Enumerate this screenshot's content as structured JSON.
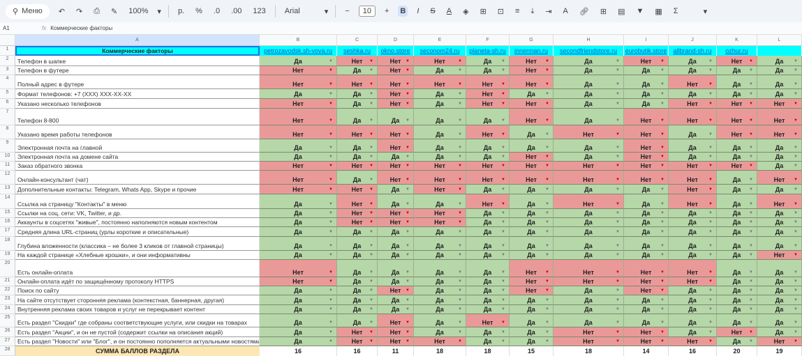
{
  "toolbar": {
    "menu": "Меню",
    "zoom": "100%",
    "currency": "р.",
    "percent": "%",
    "dec_less": ".0",
    "dec_more": ".00",
    "format": "123",
    "font": "Arial",
    "font_size": "10",
    "bold": "B",
    "italic": "I",
    "strike": "S",
    "color": "A"
  },
  "formula": {
    "cell": "A1",
    "fx": "fx",
    "value": "Коммерческие факторы"
  },
  "columns": [
    "A",
    "B",
    "C",
    "D",
    "E",
    "F",
    "G",
    "H",
    "I",
    "J",
    "K",
    "L"
  ],
  "header": {
    "title": "Коммерческие факторы",
    "sites": [
      "petrozavodsk.sh-vova.ru",
      "seshka.ru",
      "okno.store",
      "seconom24.ru",
      "planeta-sh.ru",
      "innerman.ru",
      "secondfriendstore.ru",
      "eurobutik.store",
      "allbrand-sh.ru",
      "ozhur.ru",
      ""
    ]
  },
  "rows": [
    {
      "label": "Телефон в шапке",
      "v": [
        "Да",
        "Нет",
        "Нет",
        "Нет",
        "Да",
        "Нет",
        "Да",
        "Нет",
        "Да",
        "Нет",
        "Да"
      ]
    },
    {
      "label": "Телефон в футере",
      "v": [
        "Нет",
        "Да",
        "Нет",
        "Да",
        "Да",
        "Нет",
        "Да",
        "Да",
        "Да",
        "Да",
        "Да"
      ]
    },
    {
      "label": "Полный адрес в футере",
      "v": [
        "Нет",
        "Нет",
        "Нет",
        "Нет",
        "Нет",
        "Нет",
        "Да",
        "Да",
        "Нет",
        "Да",
        "Да"
      ]
    },
    {
      "label": "Формат телефонов: +7 (XXX) XXX-XX-XX",
      "v": [
        "Да",
        "Да",
        "Нет",
        "Да",
        "Нет",
        "Да",
        "Да",
        "Да",
        "Да",
        "Да",
        "Да"
      ]
    },
    {
      "label": "Указано несколько телефонов",
      "v": [
        "Нет",
        "Да",
        "Нет",
        "Да",
        "Нет",
        "Нет",
        "Да",
        "Да",
        "Нет",
        "Нет",
        "Нет"
      ]
    },
    {
      "label": "Телефон 8-800",
      "v": [
        "Нет",
        "Да",
        "Да",
        "Да",
        "Да",
        "Нет",
        "Да",
        "Нет",
        "Нет",
        "Нет",
        "Нет"
      ]
    },
    {
      "label": "Указано время работы телефонов",
      "v": [
        "Нет",
        "Нет",
        "Нет",
        "Да",
        "Нет",
        "Да",
        "Нет",
        "Нет",
        "Да",
        "Нет",
        "Нет"
      ]
    },
    {
      "label": "Электронная почта на главной",
      "v": [
        "Да",
        "Да",
        "Нет",
        "Да",
        "Да",
        "Да",
        "Да",
        "Нет",
        "Да",
        "Да",
        "Да"
      ]
    },
    {
      "label": "Электронная почта на домене сайта",
      "v": [
        "Да",
        "Да",
        "Да",
        "Да",
        "Да",
        "Нет",
        "Да",
        "Нет",
        "Да",
        "Да",
        "Да"
      ]
    },
    {
      "label": "Заказ обратного звонка",
      "v": [
        "Нет",
        "Нет",
        "Нет",
        "Нет",
        "Нет",
        "Нет",
        "Нет",
        "Нет",
        "Нет",
        "Нет",
        "Да"
      ]
    },
    {
      "label": "Онлайн-консультант (чат)",
      "v": [
        "Нет",
        "Да",
        "Нет",
        "Нет",
        "Нет",
        "Нет",
        "Нет",
        "Нет",
        "Нет",
        "Да",
        "Нет"
      ]
    },
    {
      "label": "Дополнительные контакты: Telegram, Whats App, Skype и прочие",
      "v": [
        "Нет",
        "Нет",
        "Да",
        "Нет",
        "Да",
        "Да",
        "Да",
        "Да",
        "Нет",
        "Да",
        "Да"
      ]
    },
    {
      "label": "Ссылка на страницу \"Контакты\" в меню",
      "v": [
        "Да",
        "Нет",
        "Да",
        "Да",
        "Нет",
        "Да",
        "Нет",
        "Да",
        "Нет",
        "Да",
        "Нет"
      ]
    },
    {
      "label": "Ссылки на соц. сети: VK, Twitter, и др.",
      "v": [
        "Да",
        "Нет",
        "Нет",
        "Нет",
        "Да",
        "Да",
        "Да",
        "Да",
        "Да",
        "Да",
        "Да"
      ]
    },
    {
      "label": "Аккаунты в соцсетях \"живые\", постоянно наполняются новым контентом",
      "v": [
        "Да",
        "Нет",
        "Нет",
        "Нет",
        "Да",
        "Да",
        "Да",
        "Да",
        "Да",
        "Да",
        "Да"
      ]
    },
    {
      "label": "Средняя длина URL-страниц (урлы короткие и описательные)",
      "v": [
        "Да",
        "Да",
        "Да",
        "Да",
        "Да",
        "Да",
        "Да",
        "Да",
        "Да",
        "Да",
        "Да"
      ]
    },
    {
      "label": "Глубина вложенности (классика – не более 3 кликов от главной страницы)",
      "v": [
        "Да",
        "Да",
        "Да",
        "Да",
        "Да",
        "Да",
        "Да",
        "Да",
        "Да",
        "Да",
        "Да"
      ]
    },
    {
      "label": "На каждой странице «Хлебные крошки», и они информативны",
      "v": [
        "Да",
        "Да",
        "Да",
        "Да",
        "Да",
        "Да",
        "Да",
        "Да",
        "Да",
        "Да",
        "Нет"
      ]
    },
    {
      "label": "Есть онлайн-оплата",
      "v": [
        "Нет",
        "Да",
        "Да",
        "Да",
        "Да",
        "Нет",
        "Нет",
        "Нет",
        "Нет",
        "Да",
        "Да"
      ]
    },
    {
      "label": "Онлайн-оплата идёт по защищённому протоколу HTTPS",
      "v": [
        "Нет",
        "Да",
        "Да",
        "Да",
        "Да",
        "Нет",
        "Нет",
        "Нет",
        "Нет",
        "Да",
        "Да"
      ]
    },
    {
      "label": "Поиск по сайту",
      "v": [
        "Да",
        "Да",
        "Нет",
        "Да",
        "Да",
        "Нет",
        "Да",
        "Нет",
        "Да",
        "Да",
        "Да"
      ]
    },
    {
      "label": "На сайте отсутствует сторонняя реклама (контекстная, баннерная, другая)",
      "v": [
        "Да",
        "Да",
        "Да",
        "Да",
        "Да",
        "Да",
        "Да",
        "Да",
        "Да",
        "Да",
        "Да"
      ]
    },
    {
      "label": "Внутренняя реклама своих товаров и услуг не перекрывает контент",
      "v": [
        "Да",
        "Да",
        "Да",
        "Да",
        "Да",
        "Да",
        "Да",
        "Да",
        "Да",
        "Да",
        "Да"
      ]
    },
    {
      "label": "Есть раздел \"Скидки\" где собраны соответствующие услуги, или скидки на товарах",
      "v": [
        "Да",
        "Да",
        "Нет",
        "Да",
        "Нет",
        "Да",
        "Да",
        "Да",
        "Да",
        "Да",
        "Да"
      ]
    },
    {
      "label": "Есть раздел \"Акции\", и он не пустой (содержит ссылки на описания акций)",
      "v": [
        "Да",
        "Нет",
        "Нет",
        "Да",
        "Да",
        "Да",
        "Нет",
        "Нет",
        "Да",
        "Нет",
        "Да"
      ]
    },
    {
      "label": "Есть раздел \"Новости\" или \"Блог\", и он постоянно пополняется актуальными новостями",
      "v": [
        "Да",
        "Нет",
        "Нет",
        "Нет",
        "Да",
        "Да",
        "Нет",
        "Нет",
        "Нет",
        "Да",
        "Нет"
      ]
    }
  ],
  "summary": {
    "label": "СУММА БАЛЛОВ РАЗДЕЛА",
    "values": [
      "16",
      "16",
      "11",
      "18",
      "18",
      "15",
      "18",
      "14",
      "16",
      "20",
      "19"
    ]
  },
  "colors": {
    "yes": "#b6d7a8",
    "no": "#ea9999",
    "header": "#00ffff",
    "link": "#1155cc"
  }
}
